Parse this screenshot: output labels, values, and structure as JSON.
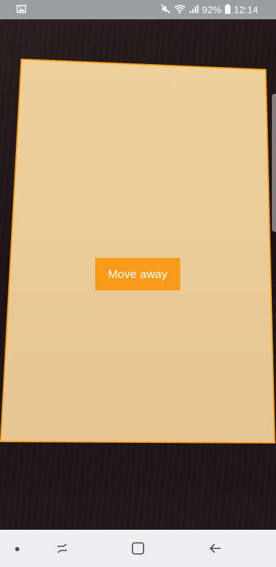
{
  "status_bar": {
    "battery_percent": "92%",
    "time": "12:14",
    "icons": [
      "gallery-icon",
      "mute-icon",
      "wifi-icon",
      "signal-icon",
      "battery-icon"
    ]
  },
  "scanner": {
    "guide_button_label": "Move away",
    "document_color": "#e9c995",
    "outline_color": "#f5a21a"
  },
  "nav_bar": {
    "buttons": [
      "nav-indicator-dot",
      "recent-apps-icon",
      "home-icon",
      "back-icon"
    ]
  }
}
